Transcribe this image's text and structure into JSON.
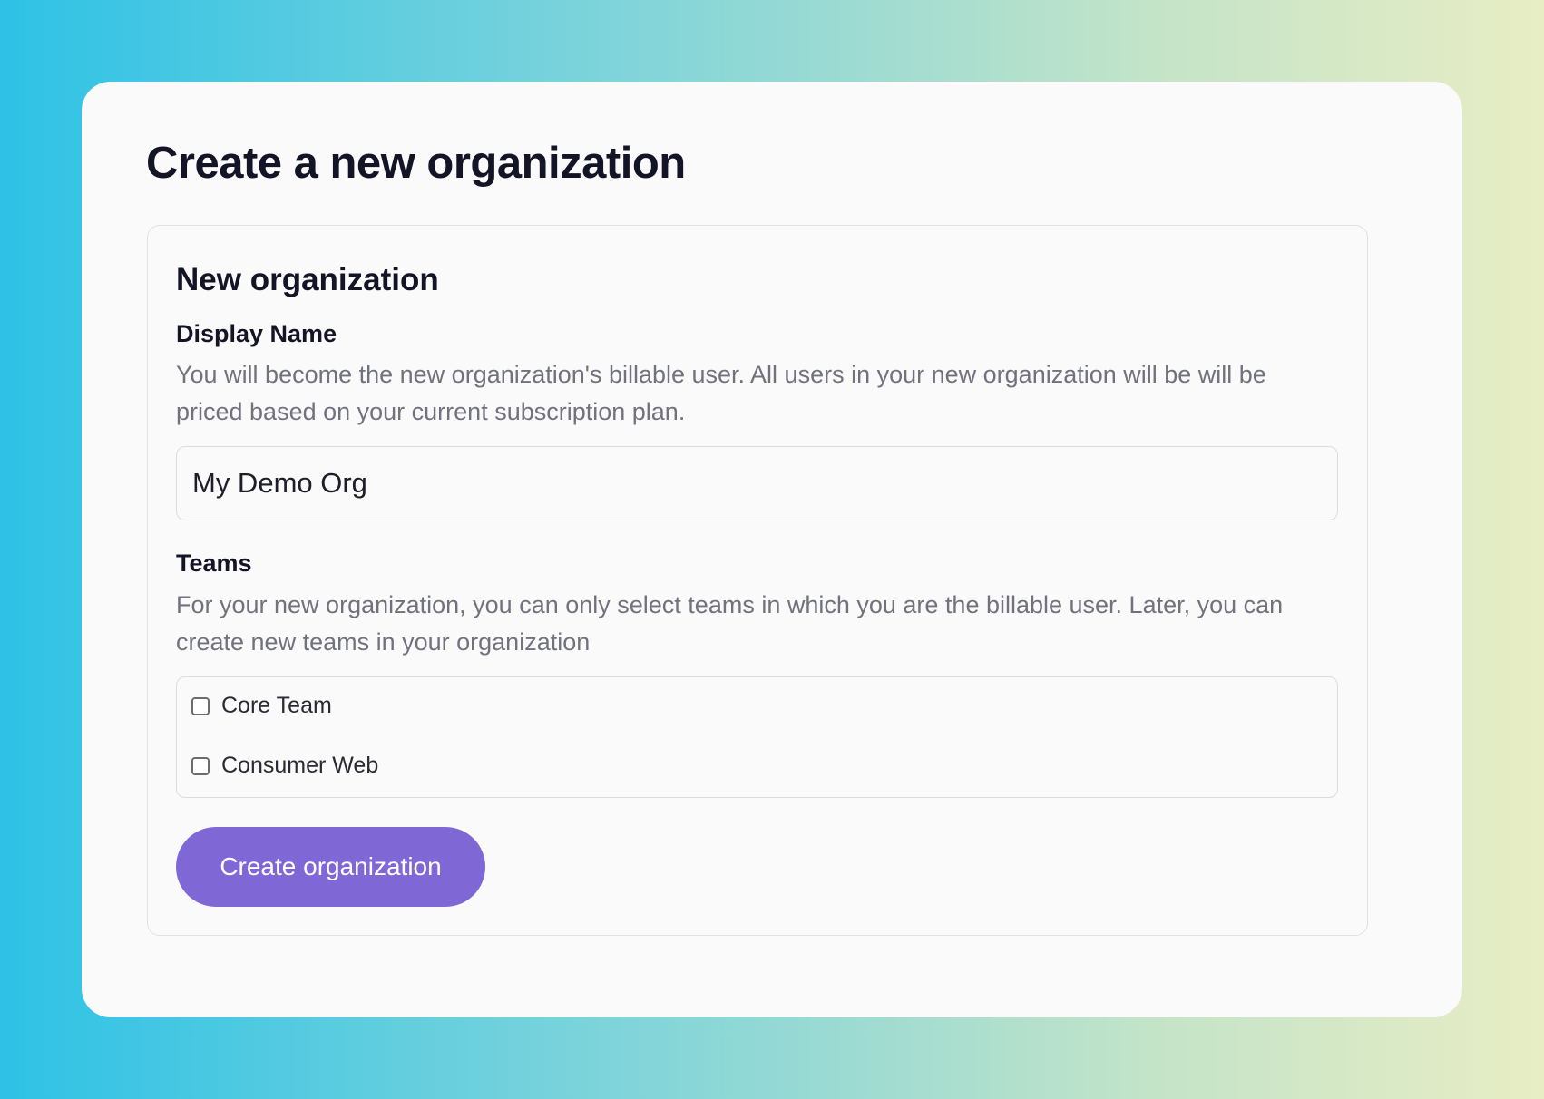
{
  "page": {
    "title": "Create a new organization"
  },
  "form": {
    "section_title": "New organization",
    "display_name": {
      "label": "Display Name",
      "help": "You will become the new organization's billable user. All users in your new organization will be will be priced based on your current subscription plan.",
      "value": "My Demo Org"
    },
    "teams": {
      "label": "Teams",
      "help": "For your new organization, you can only select teams in which you are the billable user. Later, you can create new teams in your organization",
      "options": [
        {
          "label": "Core Team",
          "checked": false
        },
        {
          "label": "Consumer Web",
          "checked": false
        }
      ]
    },
    "submit_label": "Create organization"
  },
  "colors": {
    "accent": "#7f67d6",
    "heading": "#141427",
    "muted_text": "#72727e",
    "card_background": "#fafafa"
  }
}
